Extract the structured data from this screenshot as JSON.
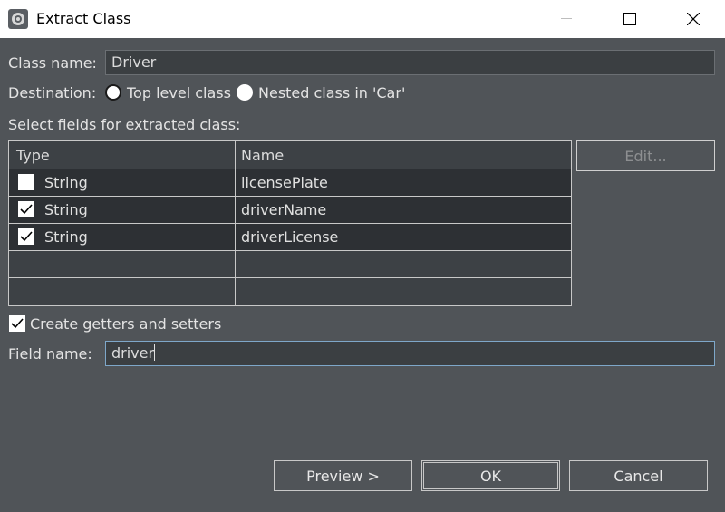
{
  "window": {
    "title": "Extract Class",
    "controls": {
      "minimize": "—",
      "maximize": "☐",
      "close": "✕"
    }
  },
  "class_name": {
    "label": "Class name:",
    "value": "Driver"
  },
  "destination": {
    "label": "Destination:",
    "options": [
      {
        "label": "Top level class",
        "selected": true
      },
      {
        "label": "Nested class in 'Car'",
        "selected": false
      }
    ]
  },
  "fields_section": {
    "label": "Select fields for extracted class:"
  },
  "table": {
    "columns": [
      "Type",
      "Name"
    ],
    "rows": [
      {
        "checked": false,
        "type": "String",
        "name": "licensePlate"
      },
      {
        "checked": true,
        "type": "String",
        "name": "driverName"
      },
      {
        "checked": true,
        "type": "String",
        "name": "driverLicense"
      }
    ]
  },
  "edit_button": {
    "label": "Edit..."
  },
  "getters_setters": {
    "label": "Create getters and setters",
    "checked": true
  },
  "field_name": {
    "label": "Field name:",
    "value": "driver"
  },
  "buttons": {
    "preview": "Preview >",
    "ok": "OK",
    "cancel": "Cancel"
  }
}
